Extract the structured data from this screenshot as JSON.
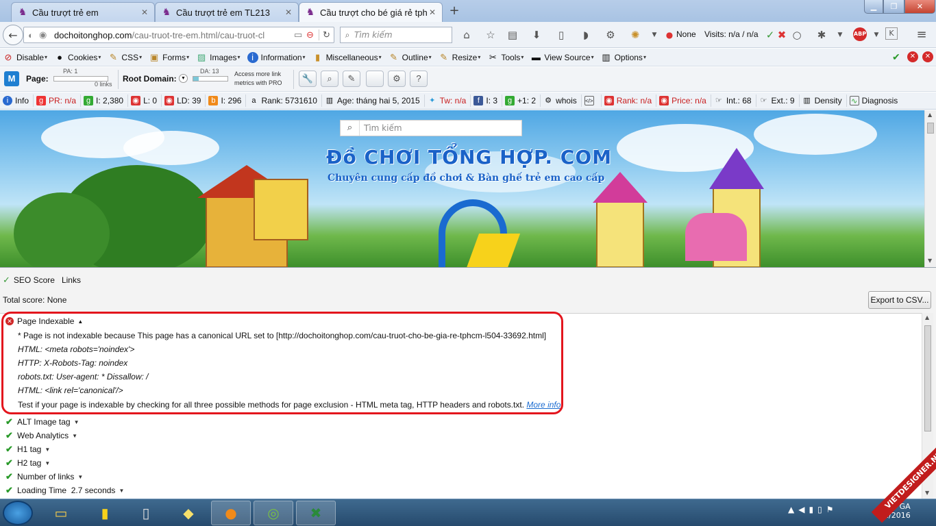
{
  "tabs": [
    {
      "title": "Cầu trượt trẻ em",
      "active": false
    },
    {
      "title": "Cầu trượt trẻ em TL213",
      "active": false
    },
    {
      "title": "Cầu trượt cho bé giá rẻ tph...",
      "active": true
    }
  ],
  "nav": {
    "url_domain": "dochoitonghop.com",
    "url_path": "/cau-truot-tre-em.html/cau-truot-cl",
    "search_placeholder": "Tìm kiếm",
    "none_label": "None",
    "visits_label": "Visits: n/a / n/a"
  },
  "webdev": {
    "items": [
      "Disable",
      "Cookies",
      "CSS",
      "Forms",
      "Images",
      "Information",
      "Miscellaneous",
      "Outline",
      "Resize",
      "Tools",
      "View Source",
      "Options"
    ]
  },
  "moz": {
    "page_label": "Page:",
    "pa_label": "PA: 1",
    "links_label": "0 links",
    "root_domain_label": "Root Domain:",
    "da_label": "DA: 13",
    "access_more_line1": "Access more link",
    "access_more_line2": "metrics with PRO"
  },
  "seobar": {
    "items": [
      "Info",
      "PR: n/a",
      "I: 2,380",
      "L: 0",
      "LD: 39",
      "I: 296",
      "Rank: 5731610",
      "Age: tháng hai 5, 2015",
      "Tw: n/a",
      "I: 3",
      "+1: 2",
      "whois",
      "",
      "Rank: n/a",
      "Price: n/a",
      "Int.: 68",
      "Ext.: 9",
      "Density",
      "Diagnosis"
    ]
  },
  "site": {
    "search_placeholder": "Tìm kiếm",
    "title": "Đồ CHƠI TỔNG HỢP. COM",
    "tagline": "Chuyên cung cấp đồ chơi & Bàn ghế trẻ em cao cấp"
  },
  "panel": {
    "tab_seo": "SEO Score",
    "tab_links": "Links",
    "total_score": "Total score: None",
    "export_button": "Export to CSV...",
    "indexable_title": "Page Indexable",
    "indexable_lines": [
      "* Page is not indexable because This page has a canonical URL set to [http://dochoitonghop.com/cau-truot-cho-be-gia-re-tphcm-l504-33692.html]",
      "HTML: <meta robots='noindex'>",
      "HTTP: X-Robots-Tag: noindex",
      "robots.txt: User-agent: * Dissallow: /",
      "HTML: <link rel='canonical'/>"
    ],
    "indexable_test": "Test if your page is indexable by checking for all three possible methods for page exclusion - HTML meta tag, HTTP headers and robots.txt.",
    "more_info": "More info",
    "checks": [
      "ALT Image tag",
      "Web Analytics",
      "H1 tag",
      "H2 tag",
      "Number of links",
      "Loading Time  2.7 seconds"
    ]
  },
  "taskbar": {
    "clock_time": "GA",
    "clock_date": "1/2016"
  },
  "watermark": "VIETDESIGNER.NET",
  "colors": {
    "highlight": "#e3151d",
    "link": "#1a6bd0",
    "check": "#2a9a2a",
    "site_title": "#1a62c8"
  }
}
